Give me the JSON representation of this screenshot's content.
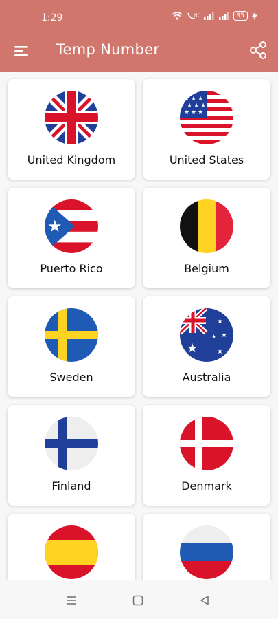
{
  "status": {
    "time": "1:29",
    "battery": "95"
  },
  "app": {
    "title": "Temp Number"
  },
  "icons": {
    "menu": "menu-icon",
    "share": "share-icon"
  },
  "colors": {
    "accent": "#d0766c",
    "card": "#ffffff"
  },
  "countries": [
    {
      "name": "United Kingdom",
      "flag": "uk-flag-icon"
    },
    {
      "name": "United States",
      "flag": "us-flag-icon"
    },
    {
      "name": "Puerto Rico",
      "flag": "puerto-rico-flag-icon"
    },
    {
      "name": "Belgium",
      "flag": "belgium-flag-icon"
    },
    {
      "name": "Sweden",
      "flag": "sweden-flag-icon"
    },
    {
      "name": "Australia",
      "flag": "australia-flag-icon"
    },
    {
      "name": "Finland",
      "flag": "finland-flag-icon"
    },
    {
      "name": "Denmark",
      "flag": "denmark-flag-icon"
    },
    {
      "name": "",
      "flag": "spain-flag-icon"
    },
    {
      "name": "",
      "flag": "russia-flag-icon"
    }
  ],
  "system_nav": [
    "recents-button",
    "home-button",
    "back-button"
  ]
}
